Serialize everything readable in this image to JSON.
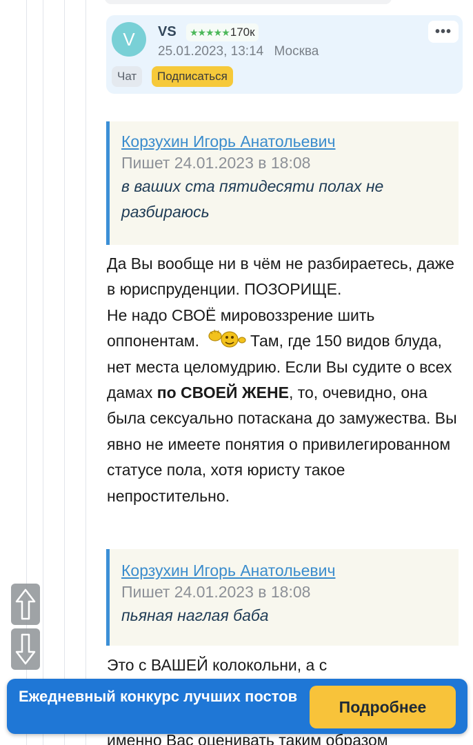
{
  "post": {
    "author": {
      "initial": "V",
      "name": "VS",
      "stars": "★★★★★",
      "rating": "170к",
      "datetime": "25.01.2023, 13:14",
      "city": "Москва",
      "more": "•••",
      "chat_label": "Чат",
      "subscribe_label": "Подписаться"
    },
    "quote1": {
      "author": "Корзухин Игорь Анатольевич",
      "date": "Пишет 24.01.2023 в 18:08",
      "text": "в ваших ста пятидесяти полах не разбираюсь"
    },
    "paragraph1": {
      "part1": "Да Вы вообще ни в чём не разбираетесь, даже в юриспруденции. ПОЗОРИЩЕ.",
      "part2": "Не надо СВОЁ мировоззрение шить оппонентам.",
      "part3": "Там, где 150 видов блуда, нет места целомудрию. Если Вы судите о всех дамах",
      "bold": "по СВОЕЙ ЖЕНЕ",
      "part4": ", то, очевидно, она была сексуально потаскана до замужества. Вы явно не имеете понятия о привилегированном статусе пола, хотя юристу такое непростительно."
    },
    "quote2": {
      "author": "Корзухин Игорь Анатольевич",
      "date": "Пишет 24.01.2023 в 18:08",
      "text": "пьяная наглая баба"
    },
    "paragraph2": {
      "visible": "Это с ВАШЕЙ колокольни, а с",
      "cutoff": "именно Вас оценивать таким образом"
    }
  },
  "promo": {
    "text": "Ежедневный конкурс лучших постов",
    "button": "Подробнее"
  },
  "colors": {
    "accent": "#1f77d6",
    "quote_border": "#3b8fd6",
    "subscribe": "#f6c93a",
    "stars": "#4cb85a"
  }
}
